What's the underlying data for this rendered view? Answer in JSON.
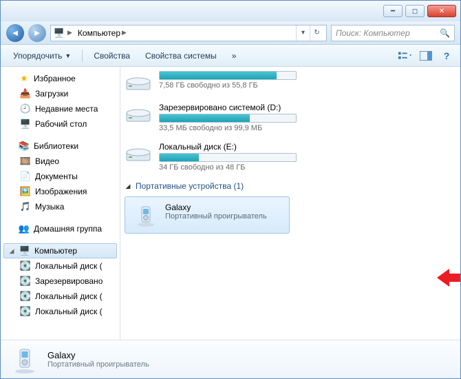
{
  "breadcrumb": {
    "root_label": "Компьютер"
  },
  "search": {
    "placeholder": "Поиск: Компьютер"
  },
  "toolbar": {
    "organize": "Упорядочить",
    "properties": "Свойства",
    "system_properties": "Свойства системы",
    "overflow": "»"
  },
  "sidebar": {
    "favorites": {
      "label": "Избранное",
      "items": [
        "Загрузки",
        "Недавние места",
        "Рабочий стол"
      ]
    },
    "libraries": {
      "label": "Библиотеки",
      "items": [
        "Видео",
        "Документы",
        "Изображения",
        "Музыка"
      ]
    },
    "homegroup": {
      "label": "Домашняя группа"
    },
    "computer": {
      "label": "Компьютер",
      "items": [
        "Локальный диск (",
        "Зарезервировано",
        "Локальный диск (",
        "Локальный диск ("
      ]
    }
  },
  "drives": [
    {
      "name": "",
      "free_text": "7,58 ГБ свободно из 55,8 ГБ",
      "fill_pct": 86
    },
    {
      "name": "Зарезервировано системой (D:)",
      "free_text": "33,5 МБ свободно из 99,9 МБ",
      "fill_pct": 66
    },
    {
      "name": "Локальный диск (E:)",
      "free_text": "34 ГБ свободно из 48 ГБ",
      "fill_pct": 29
    }
  ],
  "category": {
    "label": "Портативные устройства (1)"
  },
  "device": {
    "name": "Galaxy",
    "subtitle": "Портативный проигрыватель"
  },
  "details": {
    "name": "Galaxy",
    "subtitle": "Портативный проигрыватель"
  }
}
